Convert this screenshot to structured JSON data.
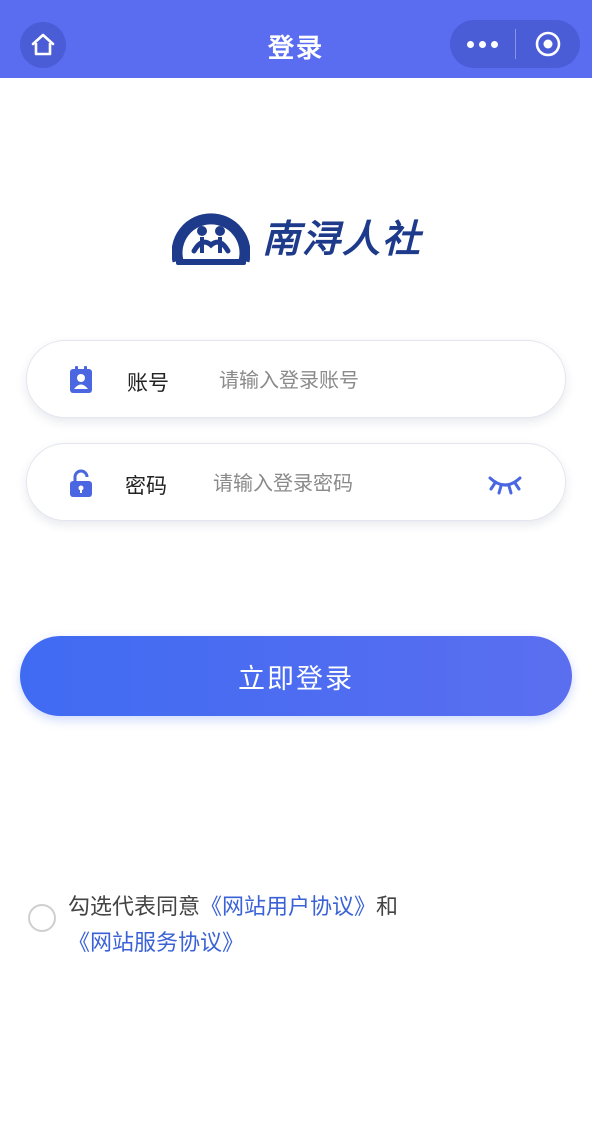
{
  "nav": {
    "title": "登录",
    "home_icon": "home-icon",
    "more_icon": "more-dots-icon",
    "close_icon": "target-close-icon",
    "bg_color": "#5a6df0"
  },
  "logo": {
    "name": "南浔人社",
    "emblem_icon": "hr-social-security-emblem"
  },
  "form": {
    "account": {
      "label": "账号",
      "placeholder": "请输入登录账号",
      "value": "",
      "icon": "account-badge-icon"
    },
    "password": {
      "label": "密码",
      "placeholder": "请输入登录密码",
      "value": "",
      "icon": "lock-icon",
      "toggle_icon": "eye-closed-icon"
    },
    "submit_label": "立即登录"
  },
  "agreement": {
    "checked": false,
    "prefix": "勾选代表同意",
    "link1": "《网站用户协议》",
    "connector": "和",
    "link2": "《网站服务协议》"
  },
  "colors": {
    "accent": "#3f6bf2",
    "link": "#3a62d6"
  }
}
